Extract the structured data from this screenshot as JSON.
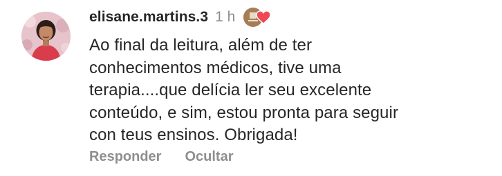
{
  "comment": {
    "username": "elisane.martins.3",
    "time": "1 h",
    "text_lines": [
      "Ao final da leitura, além de ter",
      "conhecimentos médicos, tive uma",
      "terapia....que delícia ler seu excelente",
      "conteúdo, e sim, estou pronta para seguir",
      "con teus ensinos. Obrigada!"
    ],
    "actions": {
      "reply_label": "Responder",
      "hide_label": "Ocultar"
    },
    "liked_by_author": true
  },
  "colors": {
    "primary_text": "#262626",
    "secondary_text": "#8e8e8e",
    "heart": "#ed4956"
  },
  "icons": {
    "avatar": "user-avatar",
    "liked_badge": "author-avatar-with-heart-icon"
  }
}
